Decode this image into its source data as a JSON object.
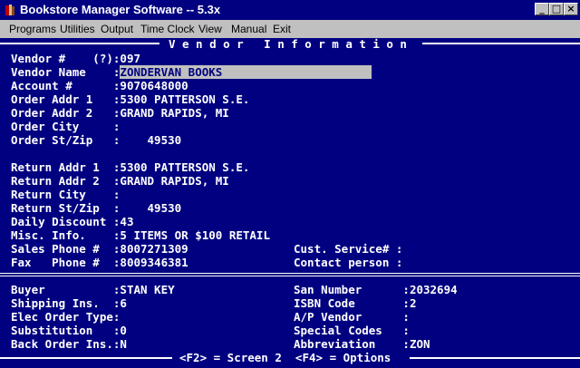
{
  "window": {
    "title": "Bookstore Manager Software -- 5.3x",
    "icon": "book-icon"
  },
  "menu": [
    "Programs",
    "Utilities",
    "Output",
    "Time Clock",
    "View",
    "Manual",
    "Exit"
  ],
  "header": "Vendor Information",
  "fields": {
    "vendor_no": {
      "label": "Vendor #    (?):",
      "value": "097"
    },
    "vendor_name": {
      "label": "Vendor Name    :",
      "value": "ZONDERVAN BOOKS"
    },
    "account": {
      "label": "Account #      :",
      "value": "9070648000"
    },
    "order_addr1": {
      "label": "Order Addr 1   :",
      "value": "5300 PATTERSON S.E."
    },
    "order_addr2": {
      "label": "Order Addr 2   :",
      "value": "GRAND RAPIDS, MI"
    },
    "order_city": {
      "label": "Order City     :",
      "value": ""
    },
    "order_stzip": {
      "label": "Order St/Zip   :",
      "value": "    49530"
    },
    "return_addr1": {
      "label": "Return Addr 1  :",
      "value": "5300 PATTERSON S.E."
    },
    "return_addr2": {
      "label": "Return Addr 2  :",
      "value": "GRAND RAPIDS, MI"
    },
    "return_city": {
      "label": "Return City    :",
      "value": ""
    },
    "return_stzip": {
      "label": "Return St/Zip  :",
      "value": "    49530"
    },
    "daily_discount": {
      "label": "Daily Discount :",
      "value": "43"
    },
    "misc_info": {
      "label": "Misc. Info.    :",
      "value": "5 ITEMS OR $100 RETAIL"
    },
    "sales_phone": {
      "label": "Sales Phone #  :",
      "value": "8007271309"
    },
    "fax_phone": {
      "label": "Fax   Phone #  :",
      "value": "8009346381"
    },
    "cust_service": {
      "label": "Cust. Service# :",
      "value": ""
    },
    "contact_person": {
      "label": "Contact person :",
      "value": ""
    },
    "buyer": {
      "label": "Buyer          :",
      "value": "STAN KEY"
    },
    "shipping_ins": {
      "label": "Shipping Ins.  :",
      "value": "6"
    },
    "elec_order_type": {
      "label": "Elec Order Type:",
      "value": ""
    },
    "substitution": {
      "label": "Substitution   :",
      "value": "0"
    },
    "back_order_ins": {
      "label": "Back Order Ins.:",
      "value": "N"
    },
    "san_number": {
      "label": "San Number      :",
      "value": "2032694"
    },
    "isbn_code": {
      "label": "ISBN Code       :",
      "value": "2"
    },
    "ap_vendor": {
      "label": "A/P Vendor      :",
      "value": ""
    },
    "special_codes": {
      "label": "Special Codes   :",
      "value": ""
    },
    "abbreviation": {
      "label": "Abbreviation    :",
      "value": "ZON"
    }
  },
  "footer": "<F2> = Screen 2  <F4> = Options"
}
